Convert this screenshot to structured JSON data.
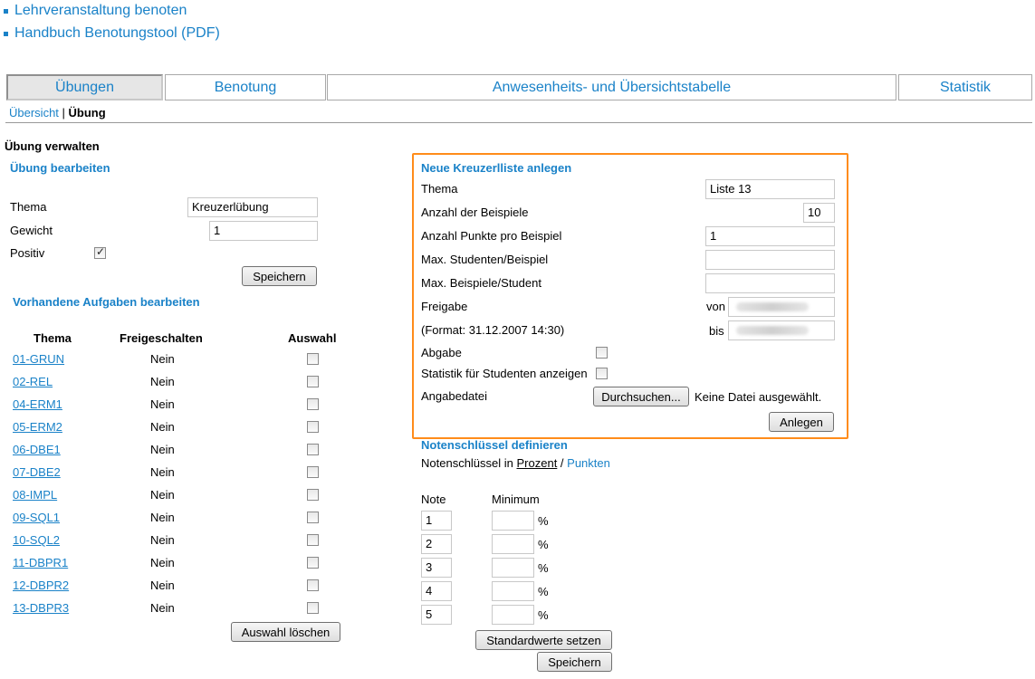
{
  "top_links": [
    "Lehrveranstaltung benoten",
    "Handbuch Benotungstool (PDF)"
  ],
  "tabs": [
    "Übungen",
    "Benotung",
    "Anwesenheits- und Übersichtstabelle",
    "Statistik"
  ],
  "breadcrumb": {
    "link": "Übersicht",
    "sep": " | ",
    "current": "Übung"
  },
  "page_title": "Übung verwalten",
  "edit": {
    "heading": "Übung bearbeiten",
    "thema_label": "Thema",
    "thema_value": "Kreuzerlübung",
    "gewicht_label": "Gewicht",
    "gewicht_value": "1",
    "positiv_label": "Positiv",
    "save": "Speichern"
  },
  "tasks": {
    "heading": "Vorhandene Aufgaben bearbeiten",
    "headers": [
      "Thema",
      "Freigeschalten",
      "Auswahl"
    ],
    "rows": [
      {
        "thema": "01-GRUN",
        "frei": "Nein"
      },
      {
        "thema": "02-REL",
        "frei": "Nein"
      },
      {
        "thema": "04-ERM1",
        "frei": "Nein"
      },
      {
        "thema": "05-ERM2",
        "frei": "Nein"
      },
      {
        "thema": "06-DBE1",
        "frei": "Nein"
      },
      {
        "thema": "07-DBE2",
        "frei": "Nein"
      },
      {
        "thema": "08-IMPL",
        "frei": "Nein"
      },
      {
        "thema": "09-SQL1",
        "frei": "Nein"
      },
      {
        "thema": "10-SQL2",
        "frei": "Nein"
      },
      {
        "thema": "11-DBPR1",
        "frei": "Nein"
      },
      {
        "thema": "12-DBPR2",
        "frei": "Nein"
      },
      {
        "thema": "13-DBPR3",
        "frei": "Nein"
      }
    ],
    "delete": "Auswahl löschen"
  },
  "new_list": {
    "heading": "Neue Kreuzerlliste anlegen",
    "thema_label": "Thema",
    "thema_value": "Liste 13",
    "anzahl_label": "Anzahl der Beispiele",
    "anzahl_value": "10",
    "punkte_label": "Anzahl Punkte pro Beispiel",
    "punkte_value": "1",
    "max_stud_label": "Max. Studenten/Beispiel",
    "max_bsp_label": "Max. Beispiele/Student",
    "freigabe_label": "Freigabe",
    "von": "von",
    "format_label": "(Format: 31.12.2007 14:30)",
    "bis": "bis",
    "abgabe_label": "Abgabe",
    "statistik_label": "Statistik für Studenten anzeigen",
    "angabe_label": "Angabedatei",
    "browse": "Durchsuchen...",
    "no_file": "Keine Datei ausgewählt.",
    "create": "Anlegen"
  },
  "grades": {
    "heading": "Notenschlüssel definieren",
    "mode_prefix": "Notenschlüssel in ",
    "mode_percent": "Prozent",
    "mode_sep": " / ",
    "mode_points": "Punkten",
    "col_note": "Note",
    "col_min": "Minimum",
    "notes": [
      "1",
      "2",
      "3",
      "4",
      "5"
    ],
    "unit": "%",
    "defaults": "Standardwerte setzen",
    "save": "Speichern"
  },
  "colors": {
    "accent": "#1a82c8",
    "panel_border": "#ff8c1a"
  }
}
